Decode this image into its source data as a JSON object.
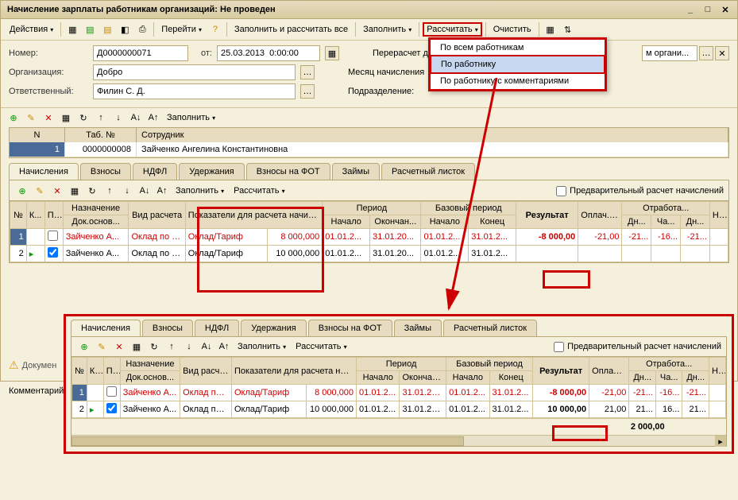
{
  "title": "Начисление зарплаты работникам организаций: Не проведен",
  "toolbar": {
    "actions": "Действия",
    "go": "Перейти",
    "fill_all": "Заполнить и рассчитать все",
    "fill": "Заполнить",
    "calc": "Рассчитать",
    "clear": "Очистить"
  },
  "menu": {
    "item1": "По всем работникам",
    "item2": "По работнику",
    "item3": "По работнику с комментариями"
  },
  "form": {
    "number_lbl": "Номер:",
    "number": "Д0000000071",
    "date_lbl": "от:",
    "date": "25.03.2013  0:00:00",
    "recalc_lbl": "Перерасчет докуме",
    "org_lbl": "Организация:",
    "org": "Добро",
    "month_lbl": "Месяц начисления",
    "resp_lbl": "Ответственный:",
    "resp": "Филин С. Д.",
    "dept_lbl": "Подразделение:",
    "org_suffix": "м органи..."
  },
  "subtb": {
    "fill": "Заполнить"
  },
  "emp_table": {
    "h_n": "N",
    "h_tab": "Таб. №",
    "h_emp": "Сотрудник",
    "n": "1",
    "tab": "0000000008",
    "emp": "Зайченко Ангелина Константиновна"
  },
  "tabs": {
    "t1": "Начисления",
    "t2": "Взносы",
    "t3": "НДФЛ",
    "t4": "Удержания",
    "t5": "Взносы на ФОТ",
    "t6": "Займы",
    "t7": "Расчетный листок"
  },
  "paneltb": {
    "fill": "Заполнить",
    "calc": "Рассчитать",
    "pre": "Предварительный расчет начислений"
  },
  "grid_headers": {
    "n": "№",
    "k": "К...",
    "p": "П...",
    "naz": "Назначение",
    "doc": "Док.основ...",
    "vid": "Вид расчета",
    "pokaz": "Показатели для расчета начисления",
    "period": "Период",
    "start": "Начало",
    "end": "Окончан...",
    "base": "Базовый период",
    "bstart": "Начало",
    "bend": "Конец",
    "result": "Результат",
    "pay": "Оплач... дней/ч...",
    "work": "Отработа...",
    "dn": "Дн...",
    "ch": "Ча...",
    "dn2": "Дн...",
    "n2": "Н..."
  },
  "grid1_rows": [
    {
      "n": "1",
      "naz": "Зайченко А...",
      "vid": "Оклад по дням",
      "pok": "Оклад/Тариф",
      "val": "8 000,000",
      "s": "01.01.2...",
      "e": "31.01.20...",
      "bs": "01.01.2...",
      "be": "31.01.2...",
      "res": "-8 000,00",
      "pay": "-21,00",
      "dn": "-21...",
      "ch": "-16...",
      "dn2": "-21..."
    },
    {
      "n": "2",
      "naz": "Зайченко А...",
      "vid": "Оклад по дням",
      "pok": "Оклад/Тариф",
      "val": "10 000,000",
      "s": "01.01.2...",
      "e": "31.01.20...",
      "bs": "01.01.2...",
      "be": "31.01.2...",
      "res": "",
      "pay": "",
      "dn": "",
      "ch": "",
      "dn2": ""
    }
  ],
  "grid2_rows": [
    {
      "n": "1",
      "naz": "Зайченко А...",
      "vid": "Оклад по дням",
      "pok": "Оклад/Тариф",
      "val": "8 000,000",
      "s": "01.01.2...",
      "e": "31.01.20...",
      "bs": "01.01.2...",
      "be": "31.01.2...",
      "res": "-8 000,00",
      "pay": "-21,00",
      "dn": "-21...",
      "ch": "-16...",
      "dn2": "-21..."
    },
    {
      "n": "2",
      "naz": "Зайченко А...",
      "vid": "Оклад по дням",
      "pok": "Оклад/Тариф",
      "val": "10 000,000",
      "s": "01.01.2...",
      "e": "31.01.20...",
      "bs": "01.01.2...",
      "be": "31.01.2...",
      "res": "10 000,00",
      "pay": "21,00",
      "dn": "21...",
      "ch": "16...",
      "dn2": "21..."
    }
  ],
  "footer_total": "2 000,00",
  "doc_warn": "Докумен",
  "comment_lbl": "Комментарий"
}
